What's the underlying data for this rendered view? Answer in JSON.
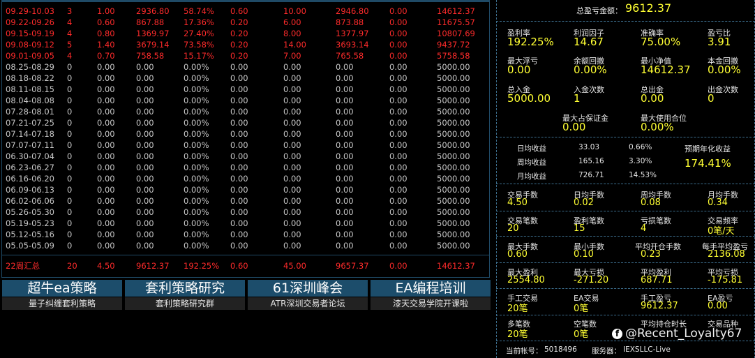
{
  "table": {
    "rows": [
      {
        "period": "09.29-10.03",
        "count": "3",
        "lots": "1.00",
        "profit": "2936.80",
        "pct": "58.74%",
        "pf": "0.60",
        "c7": "10.00",
        "c8": "2946.80",
        "c9": "0.00",
        "balance": "14612.37",
        "color": "red"
      },
      {
        "period": "09.22-09.26",
        "count": "4",
        "lots": "0.60",
        "profit": "867.88",
        "pct": "17.36%",
        "pf": "0.20",
        "c7": "6.00",
        "c8": "873.88",
        "c9": "0.00",
        "balance": "11675.57",
        "color": "red"
      },
      {
        "period": "09.15-09.19",
        "count": "4",
        "lots": "0.80",
        "profit": "1369.97",
        "pct": "27.40%",
        "pf": "0.20",
        "c7": "8.00",
        "c8": "1377.97",
        "c9": "0.00",
        "balance": "10807.69",
        "color": "red"
      },
      {
        "period": "09.08-09.12",
        "count": "5",
        "lots": "1.40",
        "profit": "3679.14",
        "pct": "73.58%",
        "pf": "0.20",
        "c7": "14.00",
        "c8": "3693.14",
        "c9": "0.00",
        "balance": "9437.72",
        "color": "red"
      },
      {
        "period": "09.01-09.05",
        "count": "4",
        "lots": "0.70",
        "profit": "758.58",
        "pct": "15.17%",
        "pf": "0.20",
        "c7": "7.00",
        "c8": "765.58",
        "c9": "0.00",
        "balance": "5758.58",
        "color": "red"
      },
      {
        "period": "08.25-08.29",
        "count": "0",
        "lots": "0.00",
        "profit": "0.00",
        "pct": "0.00%",
        "pf": "0.00",
        "c7": "0.00",
        "c8": "0.00",
        "c9": "0.00",
        "balance": "5000.00",
        "color": "gray"
      },
      {
        "period": "08.18-08.22",
        "count": "0",
        "lots": "0.00",
        "profit": "0.00",
        "pct": "0.00%",
        "pf": "0.00",
        "c7": "0.00",
        "c8": "0.00",
        "c9": "0.00",
        "balance": "5000.00",
        "color": "gray"
      },
      {
        "period": "08.11-08.15",
        "count": "0",
        "lots": "0.00",
        "profit": "0.00",
        "pct": "0.00%",
        "pf": "0.00",
        "c7": "0.00",
        "c8": "0.00",
        "c9": "0.00",
        "balance": "5000.00",
        "color": "gray"
      },
      {
        "period": "08.04-08.08",
        "count": "0",
        "lots": "0.00",
        "profit": "0.00",
        "pct": "0.00%",
        "pf": "0.00",
        "c7": "0.00",
        "c8": "0.00",
        "c9": "0.00",
        "balance": "5000.00",
        "color": "gray"
      },
      {
        "period": "07.28-08.01",
        "count": "0",
        "lots": "0.00",
        "profit": "0.00",
        "pct": "0.00%",
        "pf": "0.00",
        "c7": "0.00",
        "c8": "0.00",
        "c9": "0.00",
        "balance": "5000.00",
        "color": "gray"
      },
      {
        "period": "07.21-07.25",
        "count": "0",
        "lots": "0.00",
        "profit": "0.00",
        "pct": "0.00%",
        "pf": "0.00",
        "c7": "0.00",
        "c8": "0.00",
        "c9": "0.00",
        "balance": "5000.00",
        "color": "gray"
      },
      {
        "period": "07.14-07.18",
        "count": "0",
        "lots": "0.00",
        "profit": "0.00",
        "pct": "0.00%",
        "pf": "0.00",
        "c7": "0.00",
        "c8": "0.00",
        "c9": "0.00",
        "balance": "5000.00",
        "color": "gray"
      },
      {
        "period": "07.07-07.11",
        "count": "0",
        "lots": "0.00",
        "profit": "0.00",
        "pct": "0.00%",
        "pf": "0.00",
        "c7": "0.00",
        "c8": "0.00",
        "c9": "0.00",
        "balance": "5000.00",
        "color": "gray"
      },
      {
        "period": "06.30-07.04",
        "count": "0",
        "lots": "0.00",
        "profit": "0.00",
        "pct": "0.00%",
        "pf": "0.00",
        "c7": "0.00",
        "c8": "0.00",
        "c9": "0.00",
        "balance": "5000.00",
        "color": "gray"
      },
      {
        "period": "06.23-06.27",
        "count": "0",
        "lots": "0.00",
        "profit": "0.00",
        "pct": "0.00%",
        "pf": "0.00",
        "c7": "0.00",
        "c8": "0.00",
        "c9": "0.00",
        "balance": "5000.00",
        "color": "gray"
      },
      {
        "period": "06.16-06.20",
        "count": "0",
        "lots": "0.00",
        "profit": "0.00",
        "pct": "0.00%",
        "pf": "0.00",
        "c7": "0.00",
        "c8": "0.00",
        "c9": "0.00",
        "balance": "5000.00",
        "color": "gray"
      },
      {
        "period": "06.09-06.13",
        "count": "0",
        "lots": "0.00",
        "profit": "0.00",
        "pct": "0.00%",
        "pf": "0.00",
        "c7": "0.00",
        "c8": "0.00",
        "c9": "0.00",
        "balance": "5000.00",
        "color": "gray"
      },
      {
        "period": "06.02-06.06",
        "count": "0",
        "lots": "0.00",
        "profit": "0.00",
        "pct": "0.00%",
        "pf": "0.00",
        "c7": "0.00",
        "c8": "0.00",
        "c9": "0.00",
        "balance": "5000.00",
        "color": "gray"
      },
      {
        "period": "05.26-05.30",
        "count": "0",
        "lots": "0.00",
        "profit": "0.00",
        "pct": "0.00%",
        "pf": "0.00",
        "c7": "0.00",
        "c8": "0.00",
        "c9": "0.00",
        "balance": "5000.00",
        "color": "gray"
      },
      {
        "period": "05.19-05.23",
        "count": "0",
        "lots": "0.00",
        "profit": "0.00",
        "pct": "0.00%",
        "pf": "0.00",
        "c7": "0.00",
        "c8": "0.00",
        "c9": "0.00",
        "balance": "5000.00",
        "color": "gray"
      },
      {
        "period": "05.12-05.16",
        "count": "0",
        "lots": "0.00",
        "profit": "0.00",
        "pct": "0.00%",
        "pf": "0.00",
        "c7": "0.00",
        "c8": "0.00",
        "c9": "0.00",
        "balance": "5000.00",
        "color": "gray"
      },
      {
        "period": "05.05-05.09",
        "count": "0",
        "lots": "0.00",
        "profit": "0.00",
        "pct": "0.00%",
        "pf": "0.00",
        "c7": "0.00",
        "c8": "0.00",
        "c9": "0.00",
        "balance": "5000.00",
        "color": "gray"
      }
    ],
    "summary": {
      "period": "22周汇总",
      "count": "20",
      "lots": "4.50",
      "profit": "9612.37",
      "pct": "192.25%",
      "pf": "0.60",
      "c7": "45.00",
      "c8": "9657.37",
      "c9": "0.00",
      "balance": "14612.37"
    }
  },
  "colors": {
    "red": "#ff2b2b",
    "gray": "#c8c8c8",
    "yellow": "#ffff33",
    "accent": "#1c4d6b"
  },
  "buttons": [
    {
      "title": "超牛ea策略",
      "sub": "量子纠缠套利策略"
    },
    {
      "title": "套利策略研究",
      "sub": "套利策略研究群"
    },
    {
      "title": "61深圳峰会",
      "sub": "ATR深圳交易者论坛"
    },
    {
      "title": "EA编程培训",
      "sub": "漆天交易学院开课啦"
    }
  ],
  "stats": {
    "total_label": "总盈亏金额：",
    "total_value": "9612.37",
    "profit_rate_label": "盈利率",
    "profit_rate": "192.25%",
    "profit_factor_label": "利润因子",
    "profit_factor": "14.67",
    "accuracy_label": "准确率",
    "accuracy": "75.00%",
    "pl_ratio_label": "盈亏比",
    "pl_ratio": "3.91",
    "max_float_loss_label": "最大浮亏",
    "max_float_loss": "0.00",
    "balance_dd_label": "余额回撤",
    "balance_dd": "0.00%",
    "min_equity_label": "最小净值",
    "min_equity": "14612.37",
    "principal_dd_label": "本金回撤",
    "principal_dd": "0.00%",
    "total_deposit_label": "总入金",
    "total_deposit": "5000.00",
    "deposit_count_label": "入金次数",
    "deposit_count": "1",
    "total_withdraw_label": "总出金",
    "total_withdraw": "0.00",
    "withdraw_count_label": "出金次数",
    "withdraw_count": "0",
    "max_margin_label": "最大占保证金",
    "max_margin": "0.00",
    "max_position_label": "最大使用合位",
    "max_position": "0.00%",
    "daily_label": "日均收益",
    "daily_value": "33.03",
    "daily_pct": "0.66%",
    "weekly_label": "周均收益",
    "weekly_value": "165.16",
    "weekly_pct": "3.30%",
    "monthly_label": "月均收益",
    "monthly_value": "726.71",
    "monthly_pct": "14.53%",
    "annual_label": "预期年化收益",
    "annual_value": "174.41%",
    "lots_label": "交易手数",
    "lots": "4.50",
    "daily_lots_label": "日均手数",
    "daily_lots": "0.02",
    "weekly_lots_label": "周均手数",
    "weekly_lots": "0.08",
    "monthly_lots_label": "月均手数",
    "monthly_lots": "0.34",
    "trades_label": "交易笔数",
    "trades": "20",
    "win_trades_label": "盈利笔数",
    "win_trades": "15",
    "loss_trades_label": "亏损笔数",
    "loss_trades": "4",
    "freq_label": "交易频率",
    "freq": "0笔/天",
    "max_lot_label": "最大手数",
    "max_lot": "0.60",
    "min_lot_label": "最小手数",
    "min_lot": "0.10",
    "avg_open_lot_label": "平均开仓手数",
    "avg_open_lot": "0.23",
    "avg_lot_profit_label": "每手平均盈亏",
    "avg_lot_profit": "2136.08",
    "max_profit_label": "最大盈利",
    "max_profit": "2554.80",
    "max_loss_label": "最大亏损",
    "max_loss": "-271.20",
    "avg_profit_label": "平均盈利",
    "avg_profit": "687.71",
    "avg_loss_label": "平均亏损",
    "avg_loss": "-175.81",
    "manual_label": "手工交易",
    "manual": "20笔",
    "ea_label": "EA交易",
    "ea": "0笔",
    "manual_pl_label": "手工盈亏",
    "manual_pl": "9612.37",
    "ea_pl_label": "EA盈亏",
    "ea_pl": "0.00",
    "long_label": "多笔数",
    "long": "20笔",
    "short_label": "空笔数",
    "short": "0笔",
    "avg_hold_label": "平均持仓时长",
    "symbol_label": "交易品种",
    "account_label": "当前帐号：",
    "account": "5018496",
    "server_label": "服务器：",
    "server": "IEXSLLC-Live"
  },
  "watermark": {
    "icon": "facebook-icon",
    "text": "@Recent_Loyalty67"
  }
}
